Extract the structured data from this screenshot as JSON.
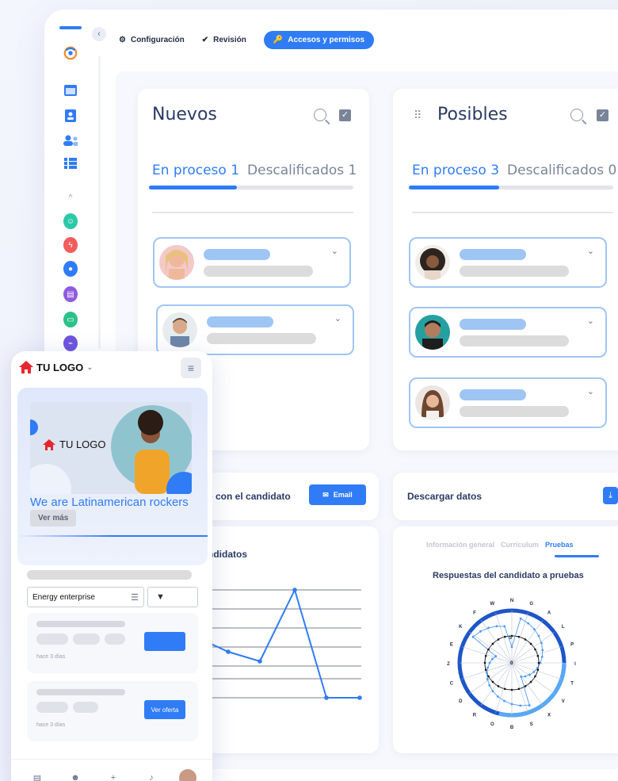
{
  "topbar": {
    "config_label": "Configuración",
    "review_label": "Revisión",
    "access_label": "Accesos y permisos"
  },
  "columns": [
    {
      "title": "Nuevos",
      "tab_active": "En proceso 1",
      "tab_inactive": "Descalificados 1",
      "progress": 0.43,
      "candidates": 2
    },
    {
      "title": "Posibles",
      "tab_active": "En proceso 3",
      "tab_inactive": "Descalificados 0",
      "progress": 0.44,
      "candidates": 3
    }
  ],
  "contact": {
    "label": "e con el candidato",
    "email_button": "Email"
  },
  "download": {
    "label": "Descargar datos"
  },
  "candidates_chart": {
    "title": "ndidatos"
  },
  "test_card": {
    "tabs": [
      "Información general",
      "Currículum",
      "Pruebas"
    ],
    "active_tab": "Pruebas",
    "title": "Respuestas del candidato a pruebas",
    "radar_labels": [
      "N",
      "G",
      "A",
      "L",
      "P",
      "I",
      "T",
      "V",
      "X",
      "S",
      "B",
      "O",
      "R",
      "D",
      "C",
      "Z",
      "E",
      "K",
      "F",
      "W"
    ],
    "inner_labels": [
      "S",
      "0"
    ]
  },
  "mobile": {
    "logo_text": "TU LOGO",
    "hero_logo_text": "TU LOGO",
    "hero_title": "We are Latinamerican rockers",
    "hero_button": "Ver más",
    "select_value": "Energy enterprise",
    "jobs": [
      {
        "time": "hace 3 días",
        "button": ""
      },
      {
        "time": "hace 3 días",
        "button": "Ver oferta"
      }
    ]
  },
  "icons": {
    "gear": "gear-icon",
    "check": "check-icon",
    "key": "key-icon",
    "search": "search-icon",
    "email": "mail-icon",
    "download": "download-icon"
  },
  "colors": {
    "accent": "#2f7cf6",
    "candidate_border": "#9fc5f5"
  }
}
